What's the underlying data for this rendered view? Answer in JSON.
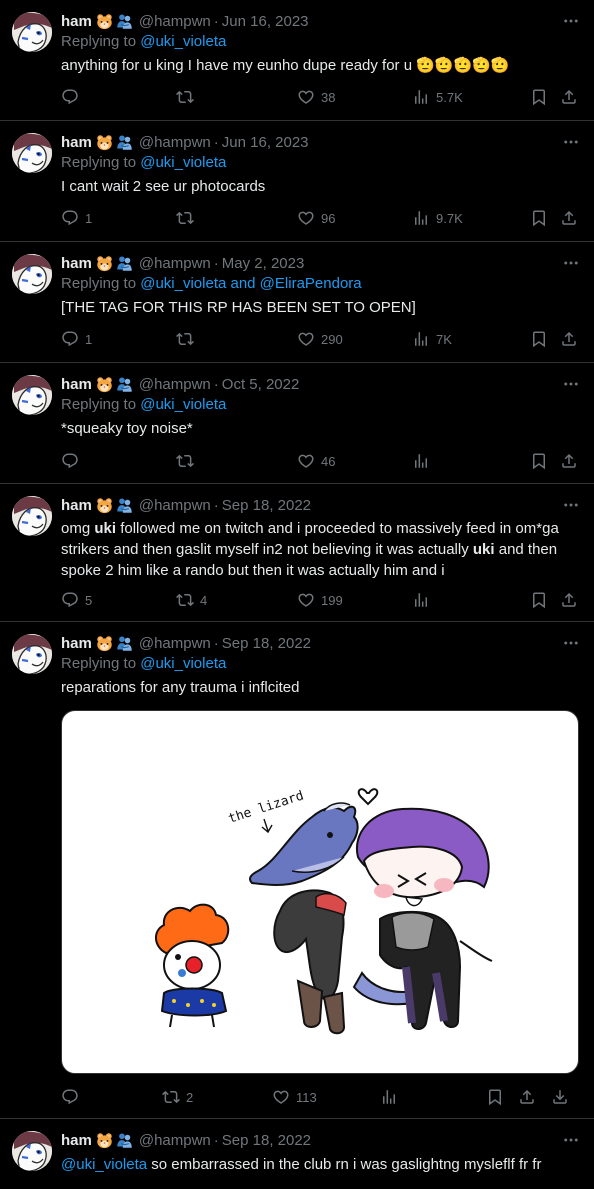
{
  "user": {
    "name": "ham",
    "handle": "@hampwn",
    "emoji": [
      "hamster-emoji",
      "people-hugging-emoji"
    ]
  },
  "tweets": [
    {
      "date": "Jun 16, 2023",
      "reply_prefix": "Replying to ",
      "reply_to": "@uki_violeta",
      "text": "anything for u king I have my eunho dupe ready for u 🫡🫡🫡🫡🫡",
      "stats": {
        "replies": "",
        "retweets": "",
        "likes": "38",
        "views": "5.7K"
      }
    },
    {
      "date": "Jun 16, 2023",
      "reply_prefix": "Replying to ",
      "reply_to": "@uki_violeta",
      "text": "I cant wait 2 see ur photocards",
      "stats": {
        "replies": "1",
        "retweets": "",
        "likes": "96",
        "views": "9.7K"
      }
    },
    {
      "date": "May 2, 2023",
      "reply_prefix": "Replying to ",
      "reply_to": "@uki_violeta and @EliraPendora",
      "text": "[THE TAG FOR THIS RP HAS BEEN SET TO OPEN]",
      "stats": {
        "replies": "1",
        "retweets": "",
        "likes": "290",
        "views": "7K"
      }
    },
    {
      "date": "Oct 5, 2022",
      "reply_prefix": "Replying to ",
      "reply_to": "@uki_violeta",
      "text": "*squeaky toy noise*",
      "stats": {
        "replies": "",
        "retweets": "",
        "likes": "46",
        "views": ""
      }
    },
    {
      "date": "Sep 18, 2022",
      "text_parts": [
        "omg ",
        "uki",
        " followed me on twitch and i proceeded to massively feed in om*ga strikers and then gaslit myself in2 not believing it was actually ",
        "uki",
        " and then spoke 2 him like a rando but then it was actually him and i"
      ],
      "stats": {
        "replies": "5",
        "retweets": "4",
        "likes": "199",
        "views": ""
      }
    },
    {
      "date": "Sep 18, 2022",
      "reply_prefix": "Replying to ",
      "reply_to": "@uki_violeta",
      "text": "reparations for any trauma i inflcited",
      "drawing_label": "the lizard",
      "stats": {
        "replies": "",
        "retweets": "2",
        "likes": "113",
        "views": ""
      }
    },
    {
      "date": "Sep 18, 2022",
      "mention": "@uki_violeta",
      "text": " so embarrassed in the club rn i was gaslightng mysleflf fr fr"
    }
  ],
  "separator": "·",
  "colors": {
    "background": "#000000",
    "text": "#e7e9ea",
    "muted": "#71767b",
    "link": "#1d9bf0",
    "divider": "#2f3336"
  }
}
